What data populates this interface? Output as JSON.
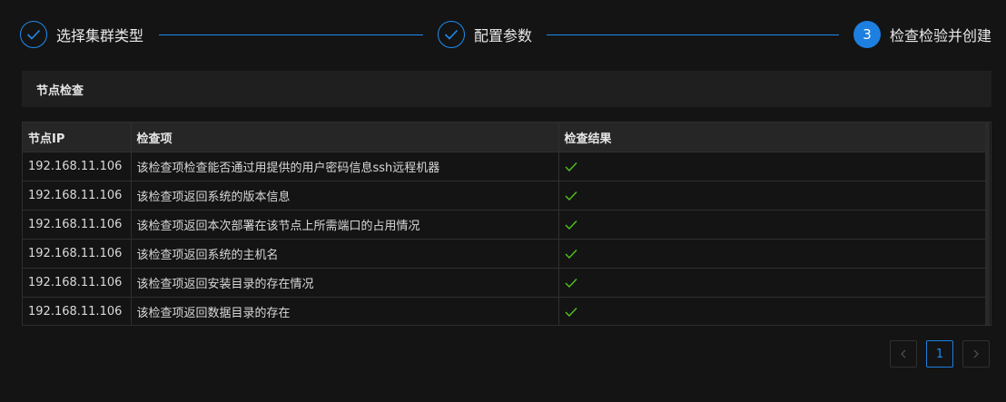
{
  "steps": [
    {
      "title": "选择集群类型",
      "status": "done",
      "icon": "check-icon"
    },
    {
      "title": "配置参数",
      "status": "done",
      "icon": "check-icon"
    },
    {
      "title": "检查检验并创建",
      "status": "active",
      "number": "3"
    }
  ],
  "section": {
    "title": "节点检查"
  },
  "table": {
    "columns": [
      "节点IP",
      "检查项",
      "检查结果"
    ],
    "rows": [
      {
        "ip": "192.168.11.106",
        "item": "该检查项检查能否通过用提供的用户密码信息ssh远程机器",
        "result": "pass"
      },
      {
        "ip": "192.168.11.106",
        "item": "该检查项返回系统的版本信息",
        "result": "pass"
      },
      {
        "ip": "192.168.11.106",
        "item": "该检查项返回本次部署在该节点上所需端口的占用情况",
        "result": "pass"
      },
      {
        "ip": "192.168.11.106",
        "item": "该检查项返回系统的主机名",
        "result": "pass"
      },
      {
        "ip": "192.168.11.106",
        "item": "该检查项返回安装目录的存在情况",
        "result": "pass"
      },
      {
        "ip": "192.168.11.106",
        "item": "该检查项返回数据目录的存在",
        "result": "pass"
      }
    ]
  },
  "pagination": {
    "current_page": "1",
    "prev_icon": "chevron-left-icon",
    "next_icon": "chevron-right-icon"
  },
  "colors": {
    "accent": "#1d7fe0",
    "check": "#52c41a",
    "background": "#141414"
  }
}
